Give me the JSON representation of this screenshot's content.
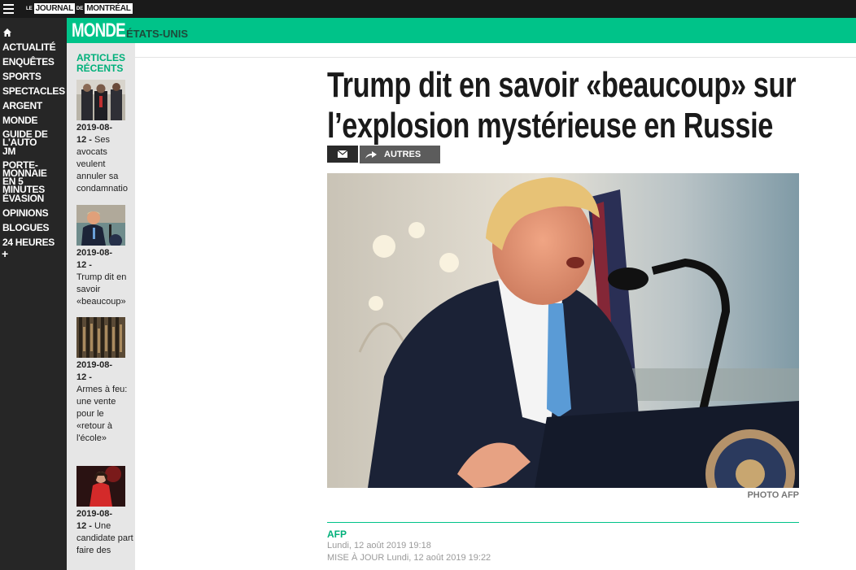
{
  "topbar": {
    "menu_icon": "hamburger-icon",
    "logo_le": "LE",
    "logo_journal": "JOURNAL",
    "logo_de": "DE",
    "logo_montreal": "MONTRÉAL"
  },
  "nav": {
    "home_icon": "home-icon",
    "items": [
      "ACTUALITÉ",
      "ENQUÊTES",
      "SPORTS",
      "SPECTACLES",
      "ARGENT",
      "MONDE",
      "GUIDE DE L'AUTO",
      "JM",
      "PORTE-MONNAIE",
      "EN 5 MINUTES",
      "ÉVASION",
      "OPINIONS",
      "BLOGUES",
      "24 HEURES"
    ],
    "more_label": "+"
  },
  "banner": {
    "section": "MONDE",
    "subsection": "ÉTATS-UNIS",
    "color": "#00c389"
  },
  "recent": {
    "title_line1": "ARTICLES",
    "title_line2": "RÉCENTS",
    "items": [
      {
        "date_a": "2019-08-",
        "date_b": "12 -",
        "text": "Ses avocats veulent annuler sa condamnatio"
      },
      {
        "date_a": "2019-08-",
        "date_b": "12 -",
        "text": "Trump dit en savoir «beaucoup»"
      },
      {
        "date_a": "2019-08-",
        "date_b": "12 -",
        "text": "Armes à feu: une vente pour le «retour à l'école»"
      },
      {
        "date_a": "2019-08-",
        "date_b": "12 -",
        "text": "Une candidate part faire des"
      }
    ]
  },
  "article": {
    "headline_line1": "Trump dit en savoir «beaucoup» sur",
    "headline_line2": "l’explosion mystérieuse en Russie",
    "share_mail_icon": "mail-icon",
    "share_others_icon": "share-arrow-icon",
    "share_others_label": "AUTRES",
    "photo_credit": "PHOTO AFP",
    "author": "AFP",
    "date": "Lundi, 12 août 2019 19:18",
    "updated": "MISE À JOUR Lundi, 12 août 2019 19:22"
  }
}
